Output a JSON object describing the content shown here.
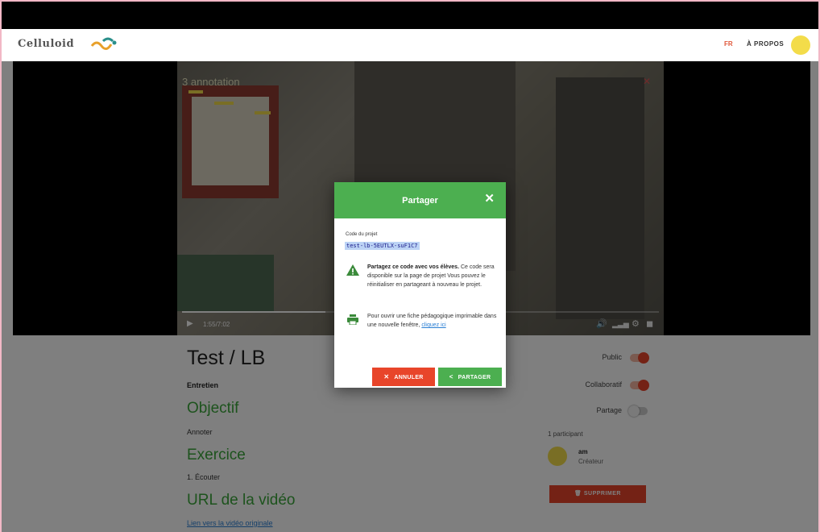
{
  "header": {
    "logo_text": "Celluloid",
    "lang": "FR",
    "about": "À PROPOS"
  },
  "video": {
    "annotation_count": "3 annotation",
    "timecode": "1:55/7:02",
    "progress": 0.3
  },
  "project": {
    "title": "Test / LB",
    "type": "Entretien",
    "objective_heading": "Objectif",
    "objective_text": "Annoter",
    "exercise_heading": "Exercice",
    "exercise_text": "1. Écouter",
    "url_heading": "URL de la vidéo",
    "url_link": "Lien vers la vidéo originale"
  },
  "settings": {
    "public_label": "Public",
    "public_on": true,
    "collab_label": "Collaboratif",
    "collab_on": true,
    "share_label": "Partage",
    "share_on": false
  },
  "participants": {
    "count_label": "1 participant",
    "name": "am",
    "role": "Créateur"
  },
  "delete_button": "SUPPRIMER",
  "modal": {
    "title": "Partager",
    "code_label": "Code du projet",
    "code": "test-lb-5EUTLX-suF1C7",
    "warn_bold": "Partagez ce code avec vos élèves.",
    "warn_rest": " Ce code sera disponible sur la page de projet Vous pouvez le réinitialiser en partageant à nouveau le projet.",
    "print_text": "Pour ouvrir une fiche pédagogique imprimable dans une nouvelle fenêtre, ",
    "print_link": "cliquez ici",
    "cancel_label": "ANNULER",
    "share_label": "PARTAGER"
  },
  "colors": {
    "brand_green": "#4caf50",
    "accent_red": "#e8452a",
    "avatar_yellow": "#f3dc4a"
  },
  "icons": [
    "logo-mark-icon",
    "avatar-icon",
    "close-icon",
    "play-icon",
    "volume-icon",
    "quality-icon",
    "settings-icon",
    "fullscreen-icon",
    "warning-icon",
    "print-icon",
    "share-icon",
    "trash-icon"
  ]
}
